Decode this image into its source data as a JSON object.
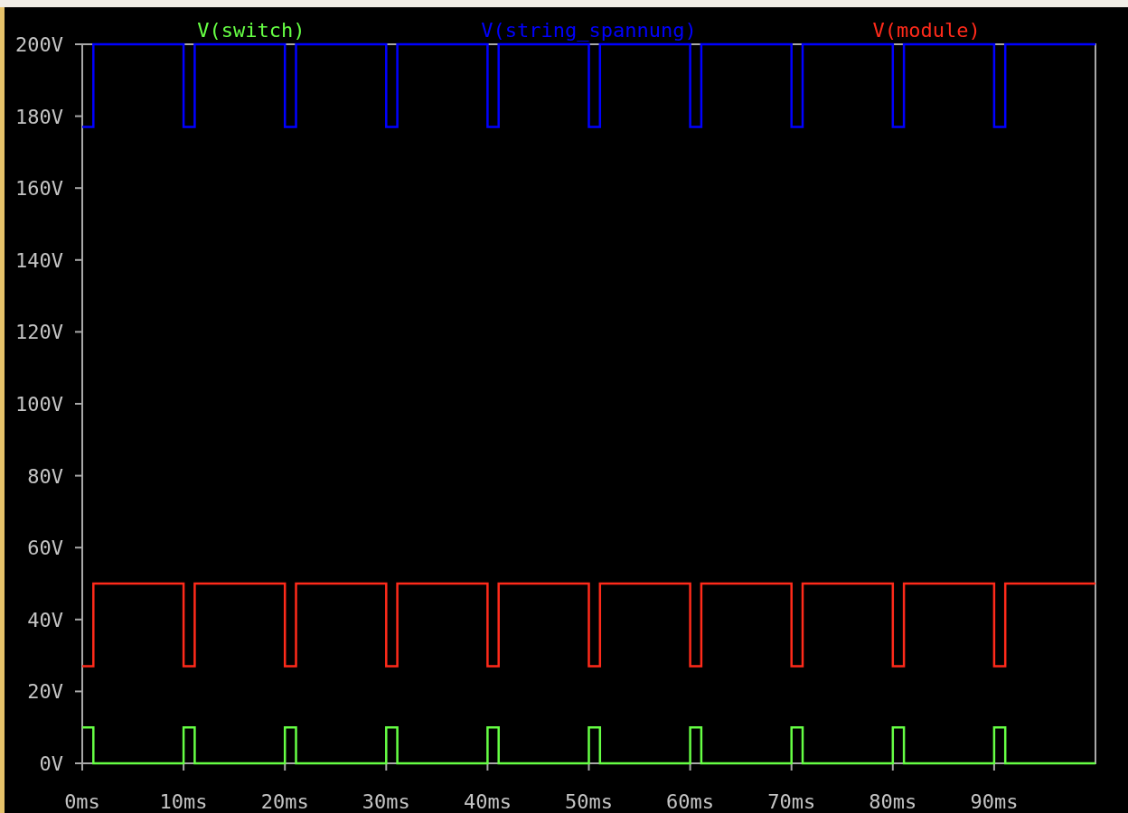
{
  "chart_data": {
    "type": "line",
    "xlim": [
      0,
      100
    ],
    "ylim": [
      0,
      200
    ],
    "xticks": [
      {
        "value": 0,
        "label": "0ms"
      },
      {
        "value": 10,
        "label": "10ms"
      },
      {
        "value": 20,
        "label": "20ms"
      },
      {
        "value": 30,
        "label": "30ms"
      },
      {
        "value": 40,
        "label": "40ms"
      },
      {
        "value": 50,
        "label": "50ms"
      },
      {
        "value": 60,
        "label": "60ms"
      },
      {
        "value": 70,
        "label": "70ms"
      },
      {
        "value": 80,
        "label": "80ms"
      },
      {
        "value": 90,
        "label": "90ms"
      }
    ],
    "yticks": [
      {
        "value": 0,
        "label": "0V"
      },
      {
        "value": 20,
        "label": "20V"
      },
      {
        "value": 40,
        "label": "40V"
      },
      {
        "value": 60,
        "label": "60V"
      },
      {
        "value": 80,
        "label": "80V"
      },
      {
        "value": 100,
        "label": "100V"
      },
      {
        "value": 120,
        "label": "120V"
      },
      {
        "value": 140,
        "label": "140V"
      },
      {
        "value": 160,
        "label": "160V"
      },
      {
        "value": 180,
        "label": "180V"
      },
      {
        "value": 200,
        "label": "200V"
      }
    ],
    "x": [
      0,
      1.1,
      1.1,
      10,
      10,
      11.1,
      11.1,
      20,
      20,
      21.1,
      21.1,
      30,
      30,
      31.1,
      31.1,
      40,
      40,
      41.1,
      41.1,
      50,
      50,
      51.1,
      51.1,
      60,
      60,
      61.1,
      61.1,
      70,
      70,
      71.1,
      71.1,
      80,
      80,
      81.1,
      81.1,
      90,
      90,
      91.1,
      91.1,
      100
    ],
    "series": [
      {
        "name": "V(switch)",
        "color": "#66ff44",
        "values": [
          10,
          10,
          0,
          0,
          10,
          10,
          0,
          0,
          10,
          10,
          0,
          0,
          10,
          10,
          0,
          0,
          10,
          10,
          0,
          0,
          10,
          10,
          0,
          0,
          10,
          10,
          0,
          0,
          10,
          10,
          0,
          0,
          10,
          10,
          0,
          0,
          10,
          10,
          0,
          0
        ]
      },
      {
        "name": "V(string_spannung)",
        "color": "#0000ff",
        "values": [
          177,
          177,
          200,
          200,
          177,
          177,
          200,
          200,
          177,
          177,
          200,
          200,
          177,
          177,
          200,
          200,
          177,
          177,
          200,
          200,
          177,
          177,
          200,
          200,
          177,
          177,
          200,
          200,
          177,
          177,
          200,
          200,
          177,
          177,
          200,
          200,
          177,
          177,
          200,
          200
        ]
      },
      {
        "name": "V(module)",
        "color": "#ff2a1a",
        "values": [
          27,
          27,
          50,
          50,
          27,
          27,
          50,
          50,
          27,
          27,
          50,
          50,
          27,
          27,
          50,
          50,
          27,
          27,
          50,
          50,
          27,
          27,
          50,
          50,
          27,
          27,
          50,
          50,
          27,
          27,
          50,
          50,
          27,
          27,
          50,
          50,
          27,
          27,
          50,
          50
        ]
      }
    ]
  }
}
